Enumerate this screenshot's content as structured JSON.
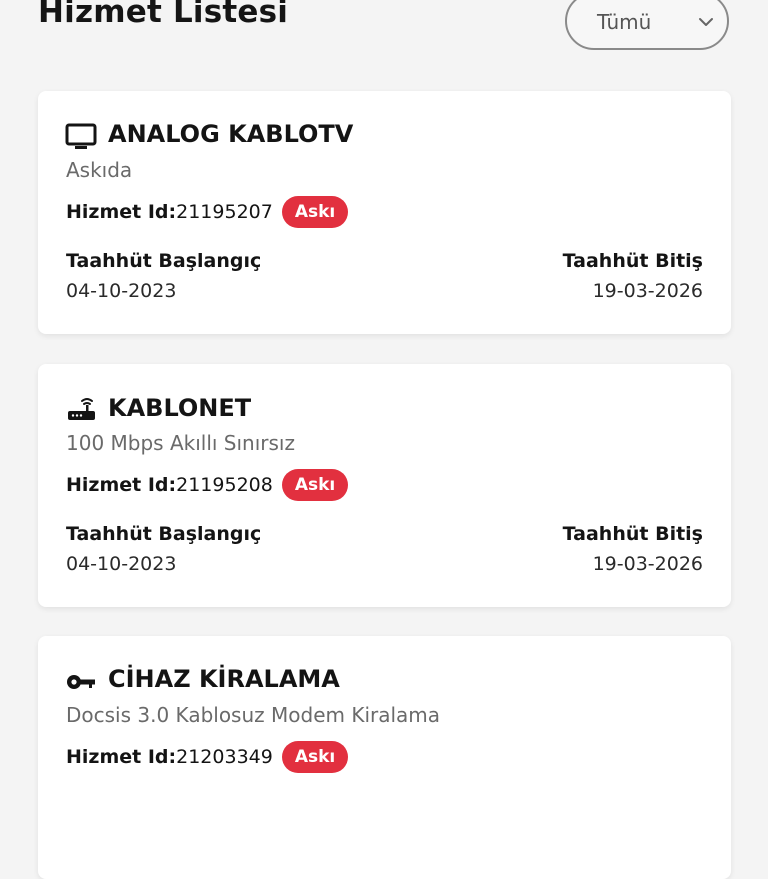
{
  "header": {
    "title": "Hizmet Listesi",
    "filter": {
      "selected": "Tümü"
    }
  },
  "labels": {
    "service_id": "Hizmet Id:",
    "commit_start": "Taahhüt Başlangıç",
    "commit_end": "Taahhüt Bitiş"
  },
  "colors": {
    "badge": "#e2303f",
    "background": "#f4f4f4"
  },
  "services": [
    {
      "icon": "tv-icon",
      "title": "ANALOG KABLOTV",
      "subtitle": "Askıda",
      "id": "21195207",
      "badge": "Askı",
      "start": "04-10-2023",
      "end": "19-03-2026"
    },
    {
      "icon": "router-icon",
      "title": "KABLONET",
      "subtitle": "100 Mbps  Akıllı Sınırsız",
      "id": "21195208",
      "badge": "Askı",
      "start": "04-10-2023",
      "end": "19-03-2026"
    },
    {
      "icon": "key-icon",
      "title": "CİHAZ KİRALAMA",
      "subtitle": "Docsis 3.0 Kablosuz Modem Kiralama",
      "id": "21203349",
      "badge": "Askı"
    }
  ]
}
